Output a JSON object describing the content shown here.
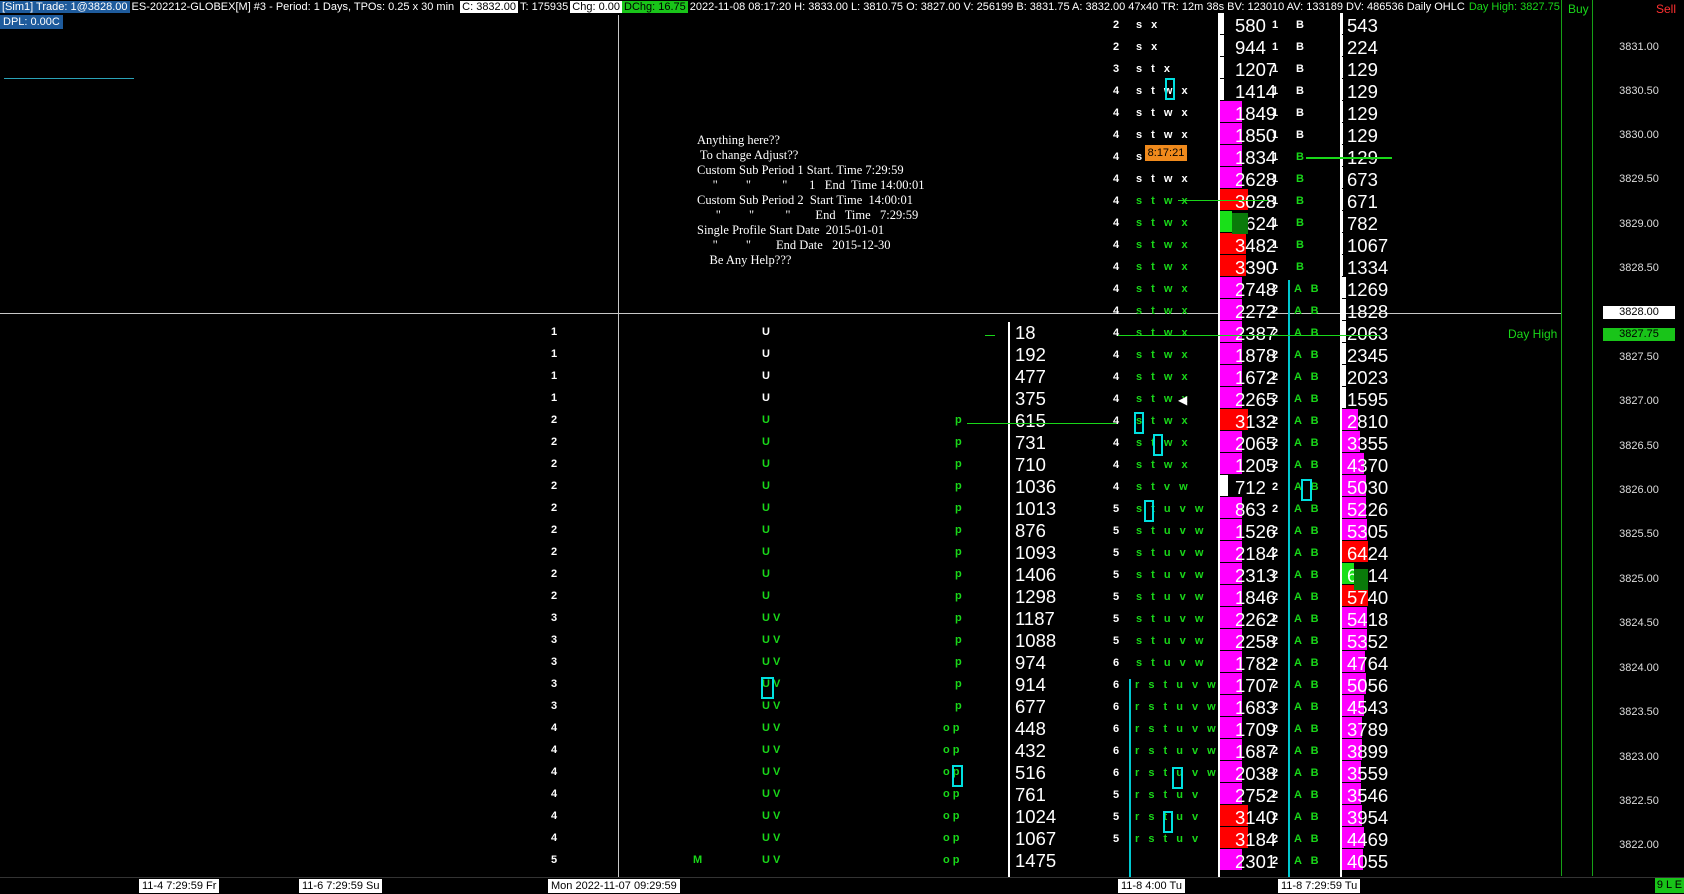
{
  "header": {
    "sim": "[Sim1]  Trade: 1@3828.00",
    "info": "ES-202212-GLOBEX[M]  #3 - Period: 1 Days, TPOs: 0.25 x 30 min",
    "close": "C: 3832.00",
    "ticks": "T: 175935",
    "chg": "Chg: 0.00",
    "dchg": "DChg: 16.75",
    "stats": "2022-11-08 08:17:20 H: 3833.00 L: 3810.75 O: 3827.00 V: 256199 B: 3831.75 A: 3832.00 47x40 TR: 12m 38s BV: 123010 AV: 133189 DV: 486536 Daily OHLC",
    "dayhigh": "Day High: 3827.75",
    "buy": "Buy",
    "sell": "Sell",
    "dpl": "DPL: 0.00C"
  },
  "note_lines": [
    "Anything here??",
    " To change Adjust??",
    "Custom Sub Period 1 Start. Time 7:29:59",
    "     \"         \"          \"       1   End  Time 14:00:01",
    "Custom Sub Period 2  Start Time  14:00:01",
    "      \"         \"          \"        End   Time   7:29:59",
    "Single Profile Start Date  2015-01-01",
    "     \"         \"        End Date   2015-12-30",
    "    Be Any Help???"
  ],
  "prices": [
    "3831.00",
    "3830.50",
    "3830.00",
    "3829.50",
    "3829.00",
    "3828.50",
    "3828.00",
    "3827.75",
    "3827.50",
    "3827.00",
    "3826.50",
    "3826.00",
    "3825.50",
    "3825.00",
    "3824.50",
    "3824.00",
    "3823.50",
    "3823.00",
    "3822.50",
    "3822.00"
  ],
  "day_high_label": "Day High",
  "clock": "8:17:21",
  "corner": "9 L E",
  "timeline": [
    "11-4  7:29:59 Fr",
    "11-6  7:29:59 Su",
    "Mon 2022-11-07  09:29:59",
    "11-8  4:00 Tu",
    "11-8  7:29:59 Tu"
  ],
  "session1": {
    "counts": [
      "1",
      "1",
      "1",
      "1",
      "2",
      "2",
      "2",
      "2",
      "2",
      "2",
      "2",
      "2",
      "2",
      "3",
      "3",
      "3",
      "3",
      "3",
      "4",
      "4",
      "4",
      "4",
      "4",
      "4",
      "5"
    ],
    "u_letters": [
      "U",
      "U",
      "U",
      "U",
      "U",
      "U",
      "U",
      "U",
      "U",
      "U",
      "U",
      "U",
      "U",
      "UV",
      "UV",
      "UV",
      "UV",
      "UV",
      "UV",
      "UV",
      "UV",
      "UV",
      "UV",
      "UV",
      "UV"
    ],
    "op_letters": [
      "",
      "",
      "",
      "",
      "p",
      "p",
      "p",
      "p",
      "p",
      "p",
      "p",
      "p",
      "p",
      "p",
      "p",
      "p",
      "p",
      "p",
      "op",
      "op",
      "op",
      "op",
      "op",
      "op",
      "op"
    ],
    "vols": [
      "18",
      "192",
      "477",
      "375",
      "615",
      "731",
      "710",
      "1036",
      "1013",
      "876",
      "1093",
      "1406",
      "1298",
      "1187",
      "1088",
      "974",
      "914",
      "677",
      "448",
      "432",
      "516",
      "761",
      "1024",
      "1067",
      "1475"
    ],
    "m_letter": "M"
  },
  "session2": {
    "counts": [
      "2",
      "2",
      "3",
      "4",
      "4",
      "4",
      "4",
      "4",
      "4",
      "4",
      "4",
      "4",
      "4",
      "4",
      "4",
      "4",
      "4",
      "4",
      "4",
      "4",
      "4",
      "4",
      "5",
      "5",
      "5",
      "5",
      "5",
      "5",
      "5",
      "6",
      "6",
      "6",
      "6",
      "6",
      "6",
      "5",
      "5",
      "5"
    ],
    "letters": [
      "s x",
      "s x",
      "s t x",
      "s t w x",
      "s t w x",
      "s t w x",
      "s",
      "s t w x",
      "s t w x",
      "s t w x",
      "s t w x",
      "s t w x",
      "s t w x",
      "s t w x",
      "s t w x",
      "s t w x",
      "s t w x",
      "s t w x",
      "s t w x",
      "s t w x",
      "s t w x",
      "s t v w",
      "s t u v w",
      "s t u v w",
      "s t u v w",
      "s t u v w",
      "s t u v w",
      "s t u v w",
      "s t u v w",
      "s t u v w",
      "r s t u v w",
      "r s t u v w",
      "r s t u v w",
      "r s t u v w",
      "r s t u v w",
      "r s t u v",
      "r s t u v",
      "r s t u v"
    ],
    "vols": [
      "580",
      "944",
      "1207",
      "1414",
      "1849",
      "1850",
      "1834",
      "2628",
      "3028",
      "3624",
      "3482",
      "3390",
      "2748",
      "2272",
      "2387",
      "1878",
      "1672",
      "2265",
      "3132",
      "2065",
      "1205",
      "712",
      "863",
      "1526",
      "2184",
      "2313",
      "1846",
      "2262",
      "2258",
      "1782",
      "1707",
      "1683",
      "1709",
      "1687",
      "2038",
      "2752",
      "3140",
      "3184",
      "2301"
    ]
  },
  "session3": {
    "counts": [
      "1",
      "1",
      "1",
      "1",
      "1",
      "1",
      "1",
      "1",
      "1",
      "1",
      "1",
      "1",
      "2",
      "2",
      "2",
      "2",
      "2",
      "2",
      "2",
      "2",
      "2",
      "2",
      "2",
      "2",
      "2",
      "2",
      "2",
      "2",
      "2",
      "2",
      "2",
      "2",
      "2",
      "2",
      "2",
      "2",
      "2",
      "2",
      "2",
      "2"
    ],
    "letters": [
      "B",
      "B",
      "B",
      "B",
      "B",
      "B",
      "B",
      "B",
      "B",
      "B",
      "B",
      "B",
      "A B",
      "A B",
      "A B",
      "A B",
      "A B",
      "A B",
      "A B",
      "A B",
      "A B",
      "A B",
      "A B",
      "A B",
      "A B",
      "A B",
      "A B",
      "A B",
      "A B",
      "A B",
      "A B",
      "A B",
      "A B",
      "A B",
      "A B",
      "A B",
      "A B",
      "A B",
      "A B",
      "A B"
    ],
    "vols": [
      "543",
      "224",
      "129",
      "129",
      "129",
      "129",
      "129",
      "673",
      "671",
      "782",
      "1067",
      "1334",
      "1269",
      "1828",
      "2063",
      "2345",
      "2023",
      "1595",
      "2810",
      "3355",
      "4370",
      "5030",
      "5226",
      "5305",
      "6424",
      "6914",
      "5740",
      "5418",
      "5352",
      "4764",
      "5056",
      "4543",
      "3789",
      "3899",
      "3559",
      "3546",
      "3954",
      "4469",
      "4055"
    ]
  },
  "colors": {
    "magenta": "#ff00ff",
    "red": "#ff0000",
    "green": "#19d719",
    "cyan": "#00e0e0",
    "orange": "#f08a1c",
    "gridline": "#c8c8c8"
  }
}
